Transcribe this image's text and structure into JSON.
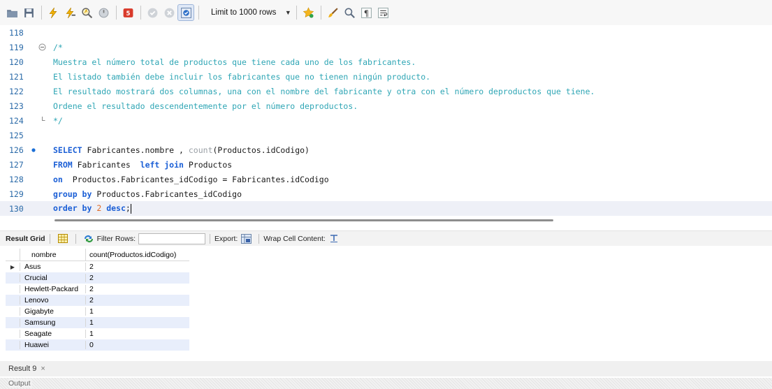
{
  "toolbar": {
    "limit_label": "Limit to 1000 rows",
    "icons": [
      "folder-icon",
      "save-icon",
      "execute-icon",
      "execute-current-icon",
      "explain-icon",
      "stop-icon",
      "error-stop-icon",
      "commit-icon",
      "rollback-icon",
      "autocommit-icon",
      "beautify-icon",
      "brush-icon",
      "find-icon",
      "invisible-chars-icon",
      "wrap-icon"
    ]
  },
  "editor": {
    "line_numbers": [
      "118",
      "119",
      "120",
      "121",
      "122",
      "123",
      "124",
      "125",
      "126",
      "127",
      "128",
      "129",
      "130"
    ],
    "comment_lines": [
      "/*",
      "Muestra el número total de productos que tiene cada uno de los fabricantes.",
      "El listado también debe incluir los fabricantes que no tienen ningún producto.",
      "El resultado mostrará dos columnas, una con el nombre del fabricante y otra con el número deproductos que tiene.",
      "Ordene el resultado descendentemente por el número deproductos.",
      "*/"
    ],
    "sql": {
      "l126_kw": "SELECT",
      "l126_a": " Fabricantes.nombre , ",
      "l126_fn": "count",
      "l126_b": "(Productos.idCodigo)",
      "l127_kw": "FROM",
      "l127_a": " Fabricantes  ",
      "l127_kw2": "left join",
      "l127_b": " Productos",
      "l128_kw": "on",
      "l128_a": "  Productos.Fabricantes_idCodigo = Fabricantes.idCodigo",
      "l129_kw": "group by",
      "l129_a": " Productos.Fabricantes_idCodigo",
      "l130_kw": "order by",
      "l130_num": "2",
      "l130_kw2": "desc",
      "l130_end": ";"
    }
  },
  "result_toolbar": {
    "result_grid": "Result Grid",
    "filter_rows": "Filter Rows:",
    "export": "Export:",
    "wrap_cell": "Wrap Cell Content:"
  },
  "grid": {
    "columns": [
      "nombre",
      "count(Productos.idCodigo)"
    ],
    "rows": [
      {
        "nombre": "Asus",
        "count": "2"
      },
      {
        "nombre": "Crucial",
        "count": "2"
      },
      {
        "nombre": "Hewlett-Packard",
        "count": "2"
      },
      {
        "nombre": "Lenovo",
        "count": "2"
      },
      {
        "nombre": "Gigabyte",
        "count": "1"
      },
      {
        "nombre": "Samsung",
        "count": "1"
      },
      {
        "nombre": "Seagate",
        "count": "1"
      },
      {
        "nombre": "Huawei",
        "count": "0"
      }
    ]
  },
  "result_tab": {
    "label": "Result 9",
    "close": "×"
  },
  "output": {
    "label": "Output"
  }
}
